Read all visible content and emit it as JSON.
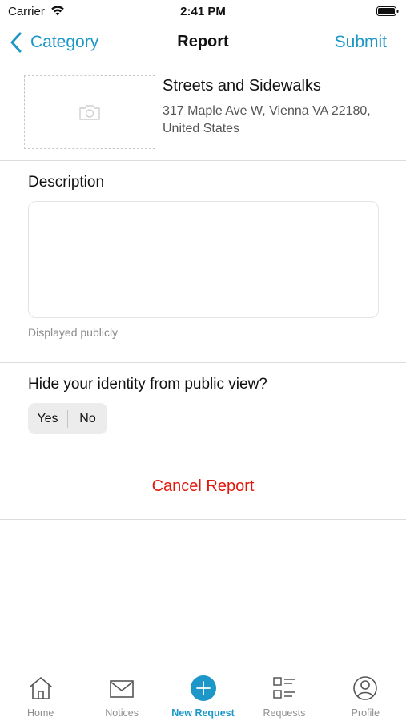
{
  "status_bar": {
    "carrier": "Carrier",
    "time": "2:41 PM"
  },
  "nav": {
    "back_label": "Category",
    "title": "Report",
    "submit_label": "Submit"
  },
  "header": {
    "category": "Streets and Sidewalks",
    "address": "317 Maple Ave W, Vienna VA 22180, United States"
  },
  "description": {
    "label": "Description",
    "value": "",
    "placeholder": "",
    "hint": "Displayed publicly"
  },
  "identity": {
    "question": "Hide your identity from public view?",
    "options": [
      "Yes",
      "No"
    ],
    "selected": null
  },
  "cancel_label": "Cancel Report",
  "tabs": [
    {
      "label": "Home",
      "icon": "home-icon"
    },
    {
      "label": "Notices",
      "icon": "envelope-icon"
    },
    {
      "label": "New Request",
      "icon": "plus-circle-icon",
      "active": true
    },
    {
      "label": "Requests",
      "icon": "list-grid-icon"
    },
    {
      "label": "Profile",
      "icon": "profile-icon"
    }
  ],
  "colors": {
    "accent": "#1c97c7",
    "destructive": "#e3180c",
    "divider": "#dcdcdc"
  }
}
